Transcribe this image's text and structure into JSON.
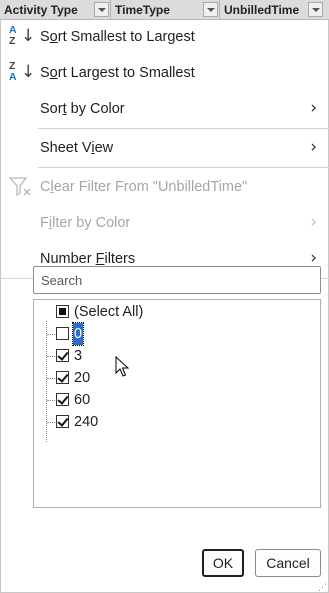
{
  "header": {
    "columns": [
      {
        "label": "Activity Type"
      },
      {
        "label": "TimeType"
      },
      {
        "label": "UnbilledTime"
      }
    ]
  },
  "menu": {
    "sort_asc": "Sort Smallest to Largest",
    "sort_desc": "Sort Largest to Smallest",
    "sort_by_color": "Sort by Color",
    "sheet_view": "Sheet View",
    "clear_filter": "Clear Filter From \"UnbilledTime\"",
    "filter_by_color": "Filter by Color",
    "number_filters": "Number Filters"
  },
  "search": {
    "placeholder": "Search"
  },
  "list": {
    "select_all": {
      "label": "(Select All)",
      "state": "partial"
    },
    "items": [
      {
        "label": "0",
        "checked": false,
        "selected": true
      },
      {
        "label": "3",
        "checked": true
      },
      {
        "label": "20",
        "checked": true
      },
      {
        "label": "60",
        "checked": true
      },
      {
        "label": "240",
        "checked": true
      }
    ]
  },
  "buttons": {
    "ok": "OK",
    "cancel": "Cancel"
  },
  "colors": {
    "accent": "#1e6fbf",
    "selection": "#2a6fc9",
    "disabled": "#a6a6a6"
  },
  "icons": [
    "sort-ascending-icon",
    "sort-descending-icon",
    "clear-filter-icon",
    "chevron-right-icon",
    "dropdown-arrow-icon",
    "mouse-pointer-icon",
    "resize-grip-icon"
  ]
}
